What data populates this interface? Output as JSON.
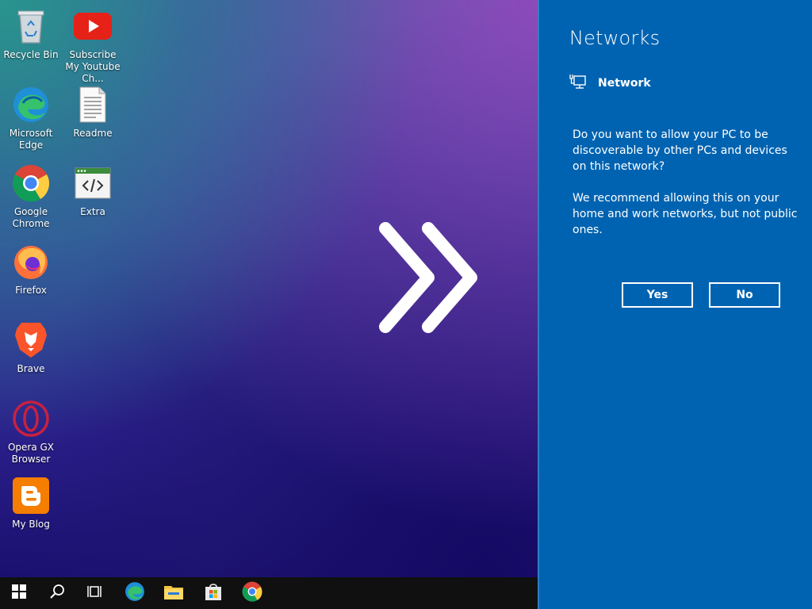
{
  "desktop": {
    "icons": [
      {
        "label": "Recycle Bin",
        "icon": "recycle-bin-icon"
      },
      {
        "label": "Subscribe My Youtube Ch...",
        "icon": "youtube-icon"
      },
      {
        "label": "Microsoft Edge",
        "icon": "edge-icon"
      },
      {
        "label": "Readme",
        "icon": "text-file-icon"
      },
      {
        "label": "Google Chrome",
        "icon": "chrome-icon"
      },
      {
        "label": "Extra",
        "icon": "code-window-icon"
      },
      {
        "label": "Firefox",
        "icon": "firefox-icon"
      },
      {
        "label": "Brave",
        "icon": "brave-icon"
      },
      {
        "label": "Opera GX Browser",
        "icon": "opera-gx-icon"
      },
      {
        "label": "My Blog",
        "icon": "blogger-icon"
      }
    ]
  },
  "taskbar": {
    "items": [
      "start-icon",
      "search-icon",
      "task-view-icon",
      "edge-icon",
      "file-explorer-icon",
      "store-icon",
      "chrome-icon"
    ]
  },
  "panel": {
    "title": "Networks",
    "network_name": "Network",
    "question": "Do you want to allow your PC to be discoverable by other PCs and devices on this network?",
    "recommendation": "We recommend allowing this on your home and work networks, but not public ones.",
    "yes_label": "Yes",
    "no_label": "No"
  },
  "colors": {
    "panel_bg": "#0063b1",
    "taskbar_bg": "#101010"
  }
}
